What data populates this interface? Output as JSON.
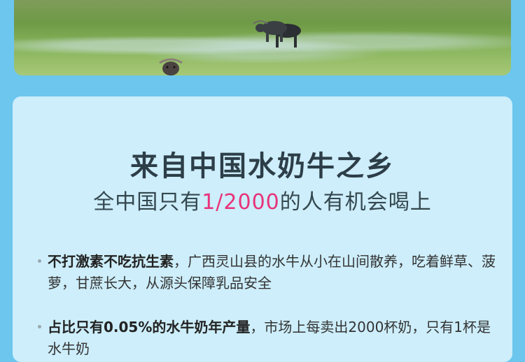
{
  "headline": {
    "title": "来自中国水奶牛之乡",
    "subtitle_pre": "全中国只有",
    "subtitle_highlight": "1/2000",
    "subtitle_post": "的人有机会喝上",
    "highlight_color": "#e8337a"
  },
  "bullets": [
    {
      "bold": "不打激素不吃抗生素",
      "text": "，广西灵山县的水牛从小在山间散养，吃着鲜草、菠萝，甘蔗长大，从源头保障乳品安全"
    },
    {
      "bold": "占比只有0.05%的水牛奶年产量",
      "text": "，市场上每卖出2000杯奶，只有1杯是水牛奶"
    }
  ],
  "colors": {
    "background": "#6cc6ee",
    "card": "#cdeefa",
    "title": "#2d3e48"
  }
}
